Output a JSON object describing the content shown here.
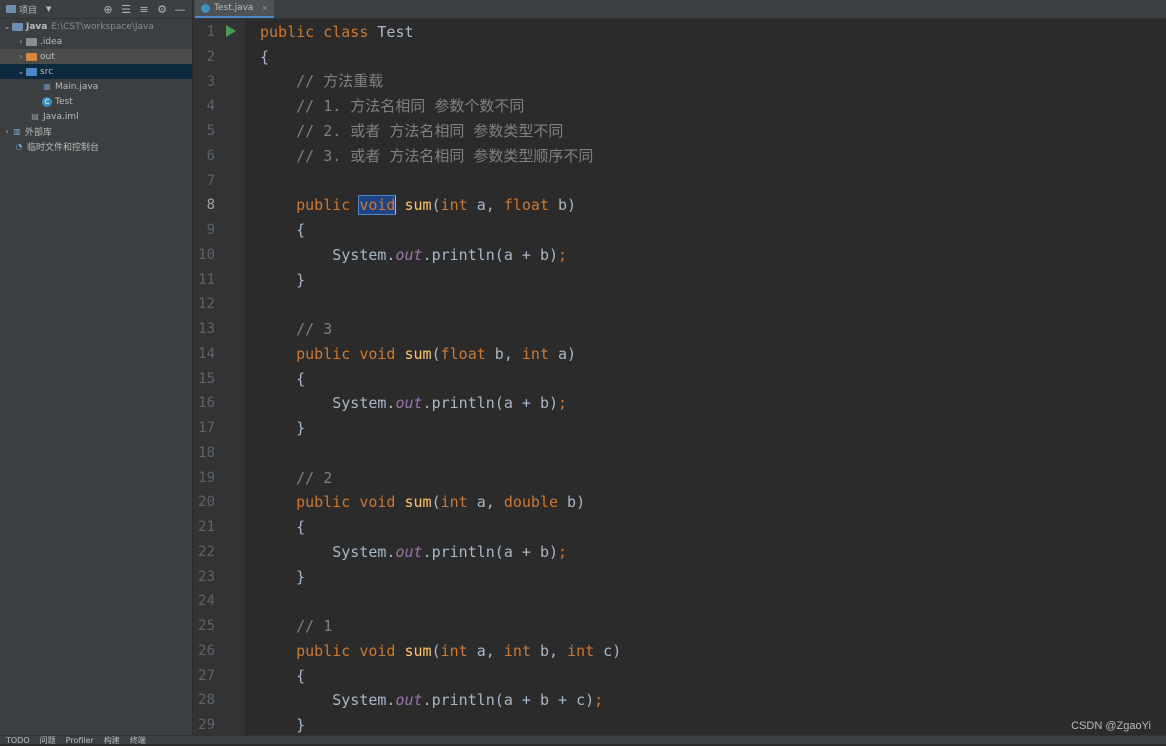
{
  "project_panel": {
    "title": "项目",
    "tree": [
      {
        "label": "Java",
        "path": "E:\\CST\\workspace\\Java"
      },
      {
        "label": ".idea"
      },
      {
        "label": "out"
      },
      {
        "label": "src"
      },
      {
        "label": "Main.java"
      },
      {
        "label": "Test"
      },
      {
        "label": "Java.iml"
      },
      {
        "label": "外部库"
      },
      {
        "label": "临时文件和控制台"
      }
    ]
  },
  "editor_tab": {
    "label": "Test.java"
  },
  "editor": {
    "line_numbers": [
      "1",
      "2",
      "3",
      "4",
      "5",
      "6",
      "7",
      "8",
      "9",
      "10",
      "11",
      "12",
      "13",
      "14",
      "15",
      "16",
      "17",
      "18",
      "19",
      "20",
      "21",
      "22",
      "23",
      "24",
      "25",
      "26",
      "27",
      "28",
      "29"
    ],
    "current_line": "8",
    "code": {
      "l1_kw": "public class ",
      "l1_name": "Test",
      "l2": "{",
      "l3": "    // 方法重载",
      "l4": "    // 1. 方法名相同 参数个数不同",
      "l5": "    // 2. 或者 方法名相同 参数类型不同",
      "l6": "    // 3. 或者 方法名相同 参数类型顺序不同",
      "public": "public",
      "void": "void",
      "sum": "sum",
      "int": "int",
      "float": "float",
      "double": "double",
      "system": "System.",
      "out": "out",
      "println_ab": ".println(a + b)",
      "println_abc": ".println(a + b + c)",
      "semi": ";",
      "open_brace": "{",
      "close_brace": "}",
      "l13": "    // 3",
      "l19": "    // 2",
      "l25": "    // 1",
      "sig1_a": "(",
      "sig1_b": " a, ",
      "sig1_c": " b)",
      "sig2_b": " b, ",
      "sig2_c": " a)",
      "sig4_c": " c)"
    }
  },
  "status_bar": {
    "items": [
      "TODO",
      "问题",
      "Profiler",
      "构建",
      "终端"
    ]
  },
  "watermark": "CSDN @ZgaoYi"
}
